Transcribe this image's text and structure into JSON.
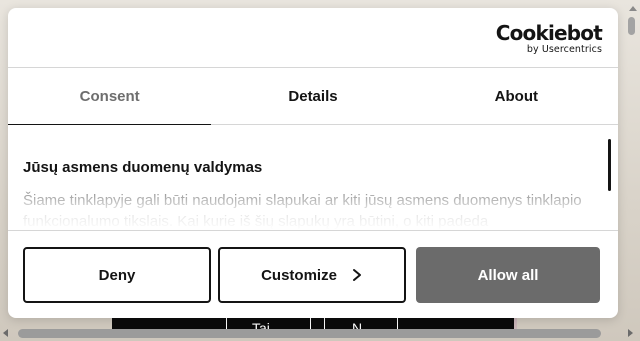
{
  "brand": {
    "name": "Cookiebot",
    "tagline": "by Usercentrics"
  },
  "tabs": [
    {
      "label": "Consent",
      "active": true
    },
    {
      "label": "Details",
      "active": false
    },
    {
      "label": "About",
      "active": false
    }
  ],
  "content": {
    "title": "Jūsų asmens duomenų valdymas",
    "text": "Šiame tinklapyje gali būti naudojami slapukai ar kiti jūsų asmens duomenys tinklapio funkcionalumo tikslais. Kai kurie iš šių slapukų yra būtini, o kiti padeda"
  },
  "buttons": {
    "deny": "Deny",
    "customize": "Customize",
    "allow_all": "Allow all"
  },
  "background": {
    "nav_items": [
      "Tai",
      "N"
    ]
  },
  "colors": {
    "allow_bg": "#6b6b6b",
    "text": "#141414",
    "inactive_tab": "#6e6e6e"
  }
}
